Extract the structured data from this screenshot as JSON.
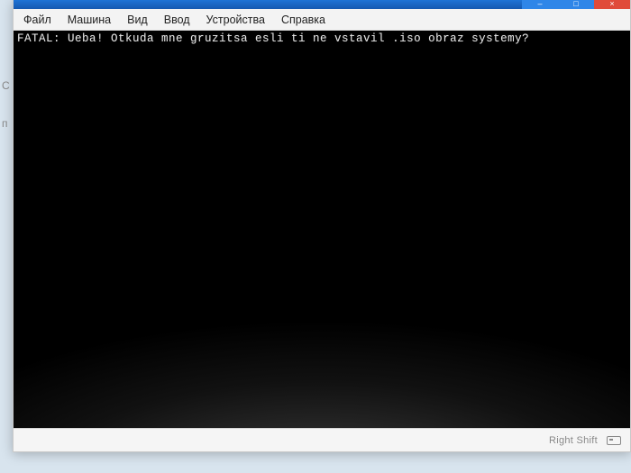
{
  "background": {
    "hint1": "С",
    "hint2": "п"
  },
  "menubar": {
    "items": [
      "Файл",
      "Машина",
      "Вид",
      "Ввод",
      "Устройства",
      "Справка"
    ]
  },
  "console": {
    "line1": "FATAL: Ueba! Otkuda mne gruzitsa esli ti ne vstavil .iso obraz systemy?"
  },
  "statusbar": {
    "hostkey": "Right Shift"
  },
  "below": ""
}
